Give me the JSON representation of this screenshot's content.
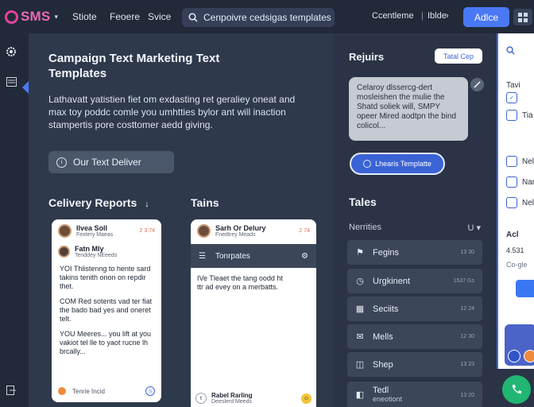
{
  "header": {
    "logo_text": "SMS",
    "nav": [
      "Stiote",
      "Feoere",
      "Svice"
    ],
    "search_text": "Cenpoivre cedsigas templates",
    "right_links": [
      "Ccentleme",
      "Iblde"
    ],
    "add_label": "Adlce"
  },
  "main": {
    "title": "Campaign Text Marketing Text Templates",
    "description": "Lathavatt yatistien fiet om exdasting ret geraliey oneat and max toy poddc comle you umhtties bylor ant will inaction stampertis pore costtomer aedd giving.",
    "hero_button": "Our Text Deliver"
  },
  "delivery": {
    "title": "Celivery Reports",
    "card": {
      "contact1_name": "Ilvea Soll",
      "contact1_sub": "Fextery Maeas",
      "contact1_time": "2 3:74",
      "contact2_name": "Fatn Mly",
      "contact2_sub": "Tenddey NEeeds",
      "message1": "YOI Thlistenng to hente sard takins tenith onon on repdir thet.",
      "message2": "COM Red sotents vad ter fiat the bado bad yes and oneret telt.",
      "message3": "YOU Meeres... you lift at you vakiot tel lle to yaot rucne lh brcally...",
      "footer": "Tenrie Incid"
    }
  },
  "trains": {
    "title": "Tains",
    "card": {
      "name": "Sarh Or Delury",
      "sub": "Fnedtrey Meads",
      "time": "2 74",
      "bar_label": "Tonrpates",
      "message": "IVe Tleaet the tang oodd ht ttr ad evey on a merbatts.",
      "footer_name": "Rabel Rarling",
      "footer_sub": "Deeslerd Meeds"
    }
  },
  "requests": {
    "title": "Rejuirs",
    "badge": "Tatal Cep",
    "bubble": "Celaroy dlssercg-dert mosleishen the mulie the Shatd soliek will, SMPY opeer Mired aodtpn the bind colicol...",
    "learn_button": "Lhearis Templatte"
  },
  "tales": {
    "title": "Tales",
    "notif_label": "Nerrities",
    "notif_value": "U",
    "items": [
      {
        "label": "Fegins",
        "count": "13 30"
      },
      {
        "label": "Urgkinent",
        "count": "1537 Gs"
      },
      {
        "label": "Seciits",
        "count": "12 24"
      },
      {
        "label": "Mells",
        "count": "12 30"
      },
      {
        "label": "Shep",
        "count": "13 23"
      },
      {
        "label": "Tedl",
        "sub": "eneotiont",
        "count": "13 20"
      }
    ]
  },
  "panel": {
    "lines": [
      "Tavi",
      "Tia",
      "Nel",
      "Nar",
      "Nel",
      "Acl",
      "4.531",
      "Co-gle"
    ]
  },
  "colors": {
    "accent": "#4a78f5",
    "brand": "#e0459a",
    "fab": "#21b673"
  }
}
